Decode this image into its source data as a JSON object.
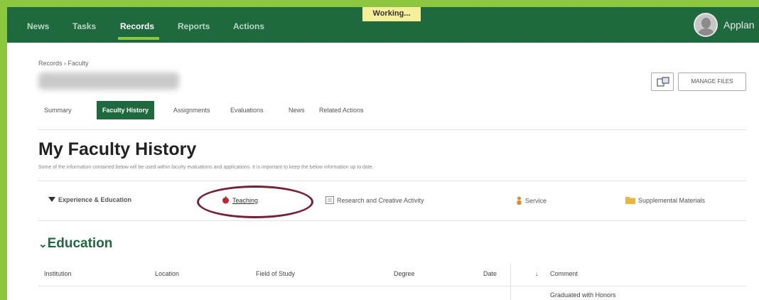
{
  "nav": {
    "items": [
      {
        "label": "News",
        "active": false
      },
      {
        "label": "Tasks",
        "active": false
      },
      {
        "label": "Records",
        "active": true
      },
      {
        "label": "Reports",
        "active": false
      },
      {
        "label": "Actions",
        "active": false
      }
    ],
    "status_badge": "Working...",
    "user_label": "Applan"
  },
  "breadcrumb": "Records › Faculty",
  "toolbar": {
    "manage_files_label": "MANAGE FILES"
  },
  "tabs": [
    {
      "label": "Summary",
      "active": false
    },
    {
      "label": "Faculty History",
      "active": true
    },
    {
      "label": "Assignments",
      "active": false
    },
    {
      "label": "Evaluations",
      "active": false
    },
    {
      "label": "News",
      "active": false
    },
    {
      "label": "Related Actions",
      "active": false
    }
  ],
  "page": {
    "title": "My Faculty History",
    "description": "Some of the information contained below will be used within faculty evaluations and applications. It is important to keep the below information up to date."
  },
  "sections": [
    {
      "label": "Experience & Education",
      "icon": "caret-down-icon"
    },
    {
      "label": "Teaching",
      "icon": "apple-icon",
      "highlighted": true
    },
    {
      "label": "Research and Creative Activity",
      "icon": "document-icon"
    },
    {
      "label": "Service",
      "icon": "person-icon"
    },
    {
      "label": "Supplemental Materials",
      "icon": "folder-icon"
    }
  ],
  "education": {
    "heading": "Education",
    "columns": [
      "Institution",
      "Location",
      "Field of Study",
      "Degree",
      "Date",
      "Comment"
    ],
    "sort_indicator": "↓",
    "first_row_comment": "Graduated with Honors"
  },
  "colors": {
    "nav_bg": "#1e6a3e",
    "accent_green": "#8dc63f",
    "highlight_ring": "#7a1f33",
    "heading_green": "#1e6a3e"
  }
}
